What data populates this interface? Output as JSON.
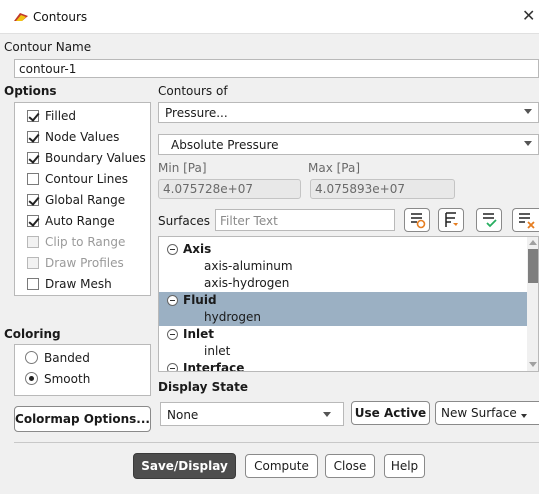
{
  "window": {
    "title": "Contours",
    "app_icon": "fluent-app-icon",
    "close_label": "✕"
  },
  "contour_name": {
    "label": "Contour Name",
    "value": "contour-1"
  },
  "options": {
    "label": "Options",
    "items": [
      {
        "label": "Filled",
        "checked": true,
        "enabled": true
      },
      {
        "label": "Node Values",
        "checked": true,
        "enabled": true
      },
      {
        "label": "Boundary Values",
        "checked": true,
        "enabled": true
      },
      {
        "label": "Contour Lines",
        "checked": false,
        "enabled": true
      },
      {
        "label": "Global Range",
        "checked": true,
        "enabled": true
      },
      {
        "label": "Auto Range",
        "checked": true,
        "enabled": true
      },
      {
        "label": "Clip to Range",
        "checked": false,
        "enabled": false
      },
      {
        "label": "Draw Profiles",
        "checked": false,
        "enabled": false
      },
      {
        "label": "Draw Mesh",
        "checked": false,
        "enabled": true
      }
    ]
  },
  "coloring": {
    "label": "Coloring",
    "items": [
      {
        "label": "Banded",
        "selected": false
      },
      {
        "label": "Smooth",
        "selected": true
      }
    ]
  },
  "colormap_button": "Colormap Options...",
  "contours_of": {
    "label": "Contours of",
    "quantity": "Pressure...",
    "subquantity": "Absolute Pressure"
  },
  "range": {
    "min_label": "Min [Pa]",
    "min_value": "4.075728e+07",
    "max_label": "Max [Pa]",
    "max_value": "4.075893e+07"
  },
  "surfaces": {
    "label": "Surfaces",
    "filter_placeholder": "Filter Text",
    "tree": [
      {
        "label": "Axis",
        "group": true,
        "selected": false
      },
      {
        "label": "axis-aluminum",
        "group": false,
        "selected": false
      },
      {
        "label": "axis-hydrogen",
        "group": false,
        "selected": false
      },
      {
        "label": "Fluid",
        "group": true,
        "selected": true
      },
      {
        "label": "hydrogen",
        "group": false,
        "selected": true
      },
      {
        "label": "Inlet",
        "group": true,
        "selected": false
      },
      {
        "label": "inlet",
        "group": false,
        "selected": false
      },
      {
        "label": "Interface",
        "group": true,
        "selected": false
      }
    ]
  },
  "display_state": {
    "label": "Display State",
    "value": "None",
    "use_active": "Use Active",
    "new_surface": "New Surface"
  },
  "footer": {
    "save_display": "Save/Display",
    "compute": "Compute",
    "close": "Close",
    "help": "Help"
  },
  "colors": {
    "selection": "#9bb0c3",
    "primary_button": "#4d4d4d"
  }
}
